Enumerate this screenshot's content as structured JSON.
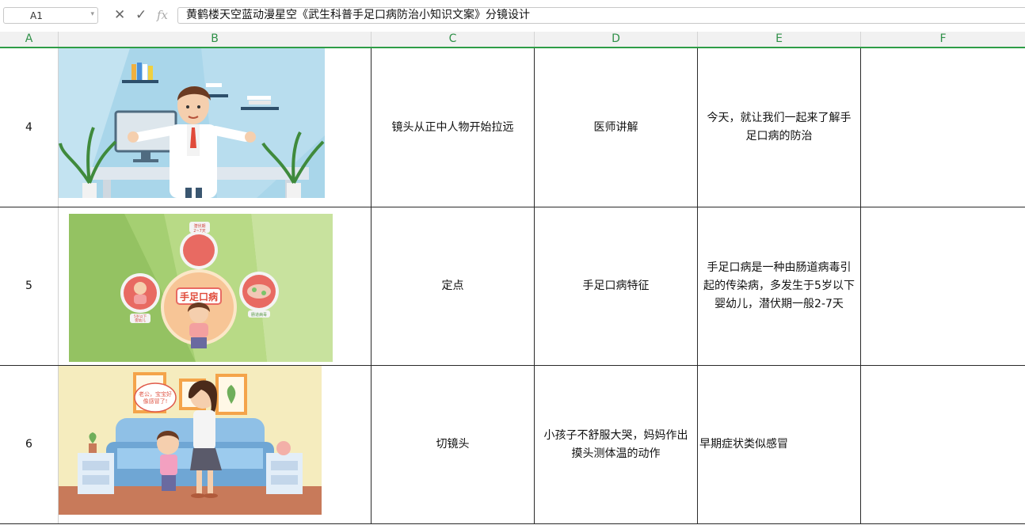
{
  "formula_bar": {
    "cell_ref": "A1",
    "cancel_icon": "close-icon",
    "confirm_icon": "check-icon",
    "fx_label": "fx",
    "content": "黄鹤楼天空蓝动漫星空《武生科普手足口病防治小知识文案》分镜设计"
  },
  "columns": [
    "A",
    "B",
    "C",
    "D",
    "E",
    "F"
  ],
  "rows": [
    {
      "num": "4",
      "image": "doctor-illustration",
      "shot": "镜头从正中人物开始拉远",
      "scene": "医师讲解",
      "copy": "今天，就让我们一起来了解手足口病的防治",
      "extra": ""
    },
    {
      "num": "5",
      "image": "hfmd-infographic",
      "shot": "定点",
      "scene": "手足口病特征",
      "copy": "手足口病是一种由肠道病毒引起的传染病，多发生于5岁以下婴幼儿，潜伏期一般2-7天",
      "extra": ""
    },
    {
      "num": "6",
      "image": "crying-child-illustration",
      "shot": "切镜头",
      "scene": "小孩子不舒服大哭，妈妈作出摸头测体温的动作",
      "copy": "早期症状类似感冒",
      "extra": ""
    }
  ],
  "illustration_text": {
    "hfmd_title": "手足口病",
    "bubble": "老公，宝宝好像感冒了!",
    "incubation": "潜伏期 2~7天",
    "under5": "5岁以下 婴幼儿",
    "virus": "肠道病毒"
  },
  "colors": {
    "accent": "#2e9d46",
    "header_bg": "#f1f1f1",
    "grid_line": "#2a2a2a"
  }
}
